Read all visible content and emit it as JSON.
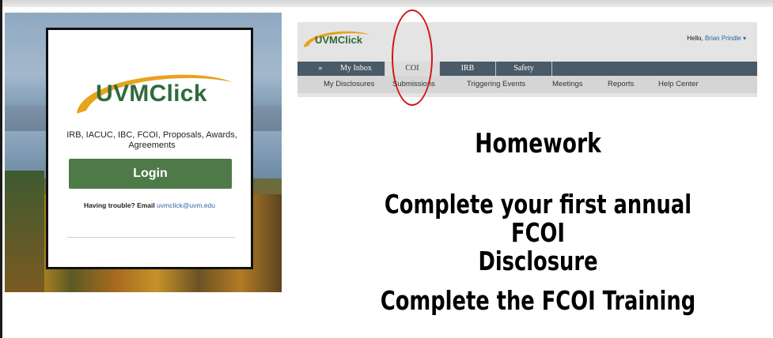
{
  "login": {
    "logo": "UVMClick",
    "subtitle": "IRB, IACUC, IBC, FCOI, Proposals, Awards, Agreements",
    "button": "Login",
    "help_prefix": "Having trouble? Email",
    "help_email": "uvmclick@uvm.edu"
  },
  "app": {
    "logo": "UVMClick",
    "greeting": "Hello,",
    "user": "Brian Prindle",
    "tabs": [
      {
        "label": "»"
      },
      {
        "label": "My Inbox"
      },
      {
        "label": "COI"
      },
      {
        "label": "IRB"
      },
      {
        "label": "Safety"
      }
    ],
    "subnav": [
      "My Disclosures",
      "Submissions",
      "Triggering Events",
      "Meetings",
      "Reports",
      "Help Center"
    ]
  },
  "slide": {
    "title": "Homework",
    "line1": "Complete your first annual FCOI",
    "line2": "Disclosure",
    "line3": "Complete the FCOI Training"
  },
  "colors": {
    "brand_green": "#2f6b3a",
    "button_green": "#4e7a48",
    "logo_swoosh": "#e8a21c",
    "tab_bar": "#4a5a66",
    "annotation_red": "#d41414"
  }
}
